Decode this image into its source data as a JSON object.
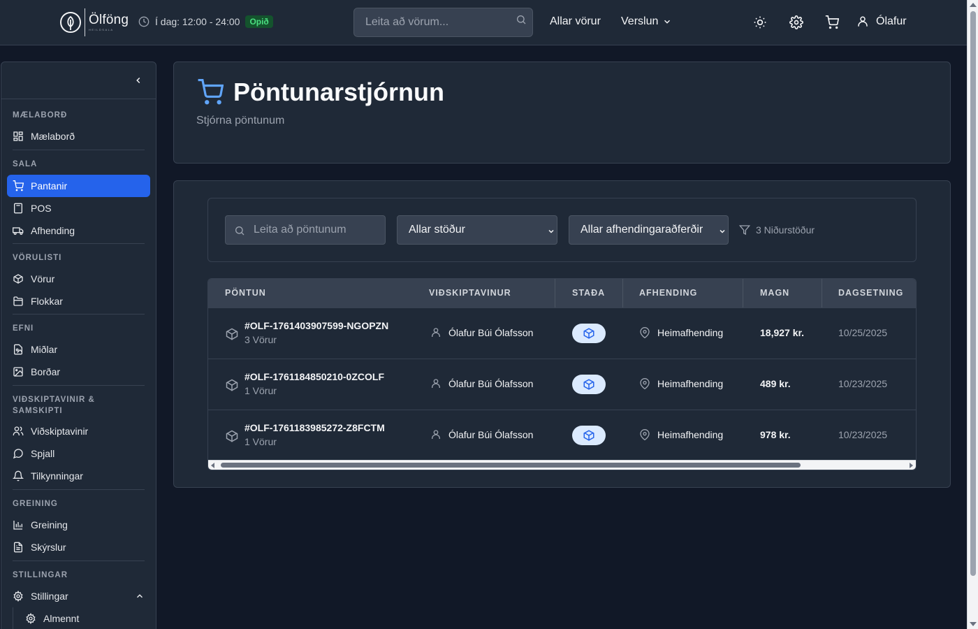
{
  "app": {
    "logo_text": "Ölföng",
    "logo_sub": "HEILDSALA",
    "hours": "Í dag: 12:00 - 24:00",
    "open_status": "Opið",
    "search_placeholder": "Leita að vörum...",
    "nav_all_products": "Allar vörur",
    "nav_shop": "Verslun",
    "user_name": "Ólafur"
  },
  "sidebar": {
    "sections": [
      {
        "title": "MÆLABORÐ",
        "items": [
          {
            "label": "Mælaborð",
            "icon": "grid-icon"
          }
        ]
      },
      {
        "title": "SALA",
        "items": [
          {
            "label": "Pantanir",
            "icon": "cart-icon",
            "active": true
          },
          {
            "label": "POS",
            "icon": "calculator-icon"
          },
          {
            "label": "Afhending",
            "icon": "truck-icon"
          }
        ]
      },
      {
        "title": "VÖRULISTI",
        "items": [
          {
            "label": "Vörur",
            "icon": "package-icon"
          },
          {
            "label": "Flokkar",
            "icon": "folder-icon"
          }
        ]
      },
      {
        "title": "EFNI",
        "items": [
          {
            "label": "Miðlar",
            "icon": "media-icon"
          },
          {
            "label": "Borðar",
            "icon": "image-icon"
          }
        ]
      },
      {
        "title": "VIÐSKIPTAVINIR & SAMSKIPTI",
        "items": [
          {
            "label": "Viðskiptavinir",
            "icon": "users-icon"
          },
          {
            "label": "Spjall",
            "icon": "chat-icon"
          },
          {
            "label": "Tilkynningar",
            "icon": "bell-icon"
          }
        ]
      },
      {
        "title": "GREINING",
        "items": [
          {
            "label": "Greining",
            "icon": "bar-chart-icon"
          },
          {
            "label": "Skýrslur",
            "icon": "file-text-icon"
          }
        ]
      },
      {
        "title": "STILLINGAR",
        "items": [
          {
            "label": "Stillingar",
            "icon": "gear-icon"
          },
          {
            "label": "Almennt",
            "icon": "gear-icon"
          }
        ]
      }
    ]
  },
  "page": {
    "title": "Pöntunarstjórnun",
    "subtitle": "Stjórna pöntunum"
  },
  "filters": {
    "search_placeholder": "Leita að pöntunum",
    "status_select": "Allar stöður",
    "delivery_select": "Allar afhendingaraðferðir",
    "results": "3 Niðurstöður"
  },
  "table": {
    "columns": [
      "PÖNTUN",
      "VIÐSKIPTAVINUR",
      "STAÐA",
      "AFHENDING",
      "MAGN",
      "DAGSETNING"
    ],
    "rows": [
      {
        "order": "#OLF-1761403907599-NGOPZN",
        "items": "3 Vörur",
        "customer": "Ólafur Búi Ólafsson",
        "status_icon": "package-icon",
        "delivery": "Heimafhending",
        "amount": "18,927 kr.",
        "date": "10/25/2025"
      },
      {
        "order": "#OLF-1761184850210-0ZCOLF",
        "items": "1 Vörur",
        "customer": "Ólafur Búi Ólafsson",
        "status_icon": "package-icon",
        "delivery": "Heimafhending",
        "amount": "489 kr.",
        "date": "10/23/2025"
      },
      {
        "order": "#OLF-1761183985272-Z8FCTM",
        "items": "1 Vörur",
        "customer": "Ólafur Búi Ólafsson",
        "status_icon": "package-icon",
        "delivery": "Heimafhending",
        "amount": "978 kr.",
        "date": "10/23/2025"
      }
    ]
  },
  "colors": {
    "background": "#111827",
    "panel": "#1f2937",
    "accent": "#2563eb",
    "icon_blue": "#60a5fa",
    "open_badge": "#4ade80"
  }
}
